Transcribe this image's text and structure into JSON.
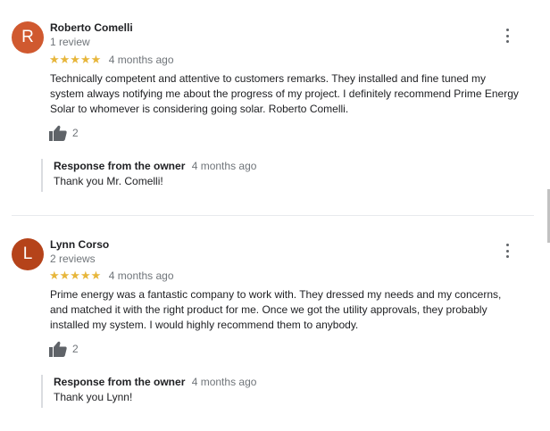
{
  "reviews": [
    {
      "avatar_letter": "R",
      "avatar_color": "#d0592f",
      "name": "Roberto Comelli",
      "count": "1 review",
      "stars": "★★★★★",
      "age": "4 months ago",
      "text": "Technically competent and attentive to customers remarks. They installed and fine tuned my system always notifying me about the progress of my project. I definitely recommend Prime Energy Solar to whomever is considering going solar. Roberto Comelli.",
      "likes": "2",
      "response": {
        "label": "Response from the owner",
        "age": "4 months ago",
        "text": "Thank you Mr. Comelli!"
      }
    },
    {
      "avatar_letter": "L",
      "avatar_color": "#b5431a",
      "name": "Lynn Corso",
      "count": "2 reviews",
      "stars": "★★★★★",
      "age": "4 months ago",
      "text": "Prime energy was a fantastic company to work with. They dressed my needs and my concerns, and matched it with the right product for me. Once we got the utility approvals, they probably installed my system. I would highly recommend them to anybody.",
      "likes": "2",
      "response": {
        "label": "Response from the owner",
        "age": "4 months ago",
        "text": "Thank you Lynn!"
      }
    }
  ],
  "colors": {
    "star": "#e7b63b",
    "muted_text": "#70757a",
    "thumb_icon": "#5f6368"
  },
  "icons": {
    "menu": "more-vert-icon",
    "like": "thumbs-up-icon",
    "rating": "star-icon"
  }
}
